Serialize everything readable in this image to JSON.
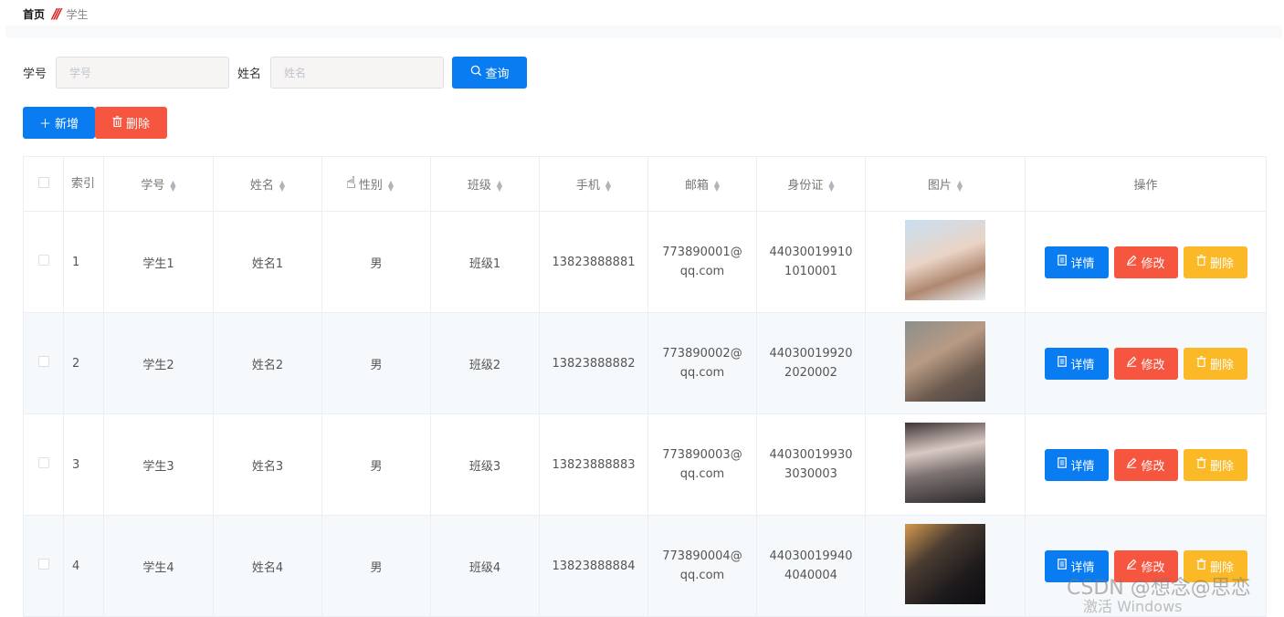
{
  "breadcrumb": {
    "home": "首页",
    "separator": "///",
    "current": "学生"
  },
  "search": {
    "student_id_label": "学号",
    "student_id_placeholder": "学号",
    "name_label": "姓名",
    "name_placeholder": "姓名",
    "query_label": "查询"
  },
  "actions": {
    "add_label": "新增",
    "delete_label": "删除"
  },
  "table": {
    "headers": {
      "index": "索引",
      "student_id": "学号",
      "name": "姓名",
      "gender": "性别",
      "class": "班级",
      "phone": "手机",
      "email": "邮箱",
      "id_card": "身份证",
      "photo": "图片",
      "operation": "操作"
    },
    "rows": [
      {
        "index": "1",
        "student_id": "学生1",
        "name": "姓名1",
        "gender": "男",
        "class": "班级1",
        "phone": "13823888881",
        "email": "773890001@qq.com",
        "id_card": "440300199101010001"
      },
      {
        "index": "2",
        "student_id": "学生2",
        "name": "姓名2",
        "gender": "男",
        "class": "班级2",
        "phone": "13823888882",
        "email": "773890002@qq.com",
        "id_card": "440300199202020002"
      },
      {
        "index": "3",
        "student_id": "学生3",
        "name": "姓名3",
        "gender": "男",
        "class": "班级3",
        "phone": "13823888883",
        "email": "773890003@qq.com",
        "id_card": "440300199303030003"
      },
      {
        "index": "4",
        "student_id": "学生4",
        "name": "姓名4",
        "gender": "男",
        "class": "班级4",
        "phone": "13823888884",
        "email": "773890004@qq.com",
        "id_card": "440300199404040004"
      }
    ],
    "row_actions": {
      "detail": "详情",
      "edit": "修改",
      "delete": "删除"
    }
  },
  "watermarks": {
    "csdn": "CSDN @想念@思恋",
    "windows": "激活 Windows"
  },
  "colors": {
    "primary": "#0a7cf2",
    "danger": "#f6553f",
    "warning": "#fcb927",
    "row_alt": "#f5f9fc"
  }
}
